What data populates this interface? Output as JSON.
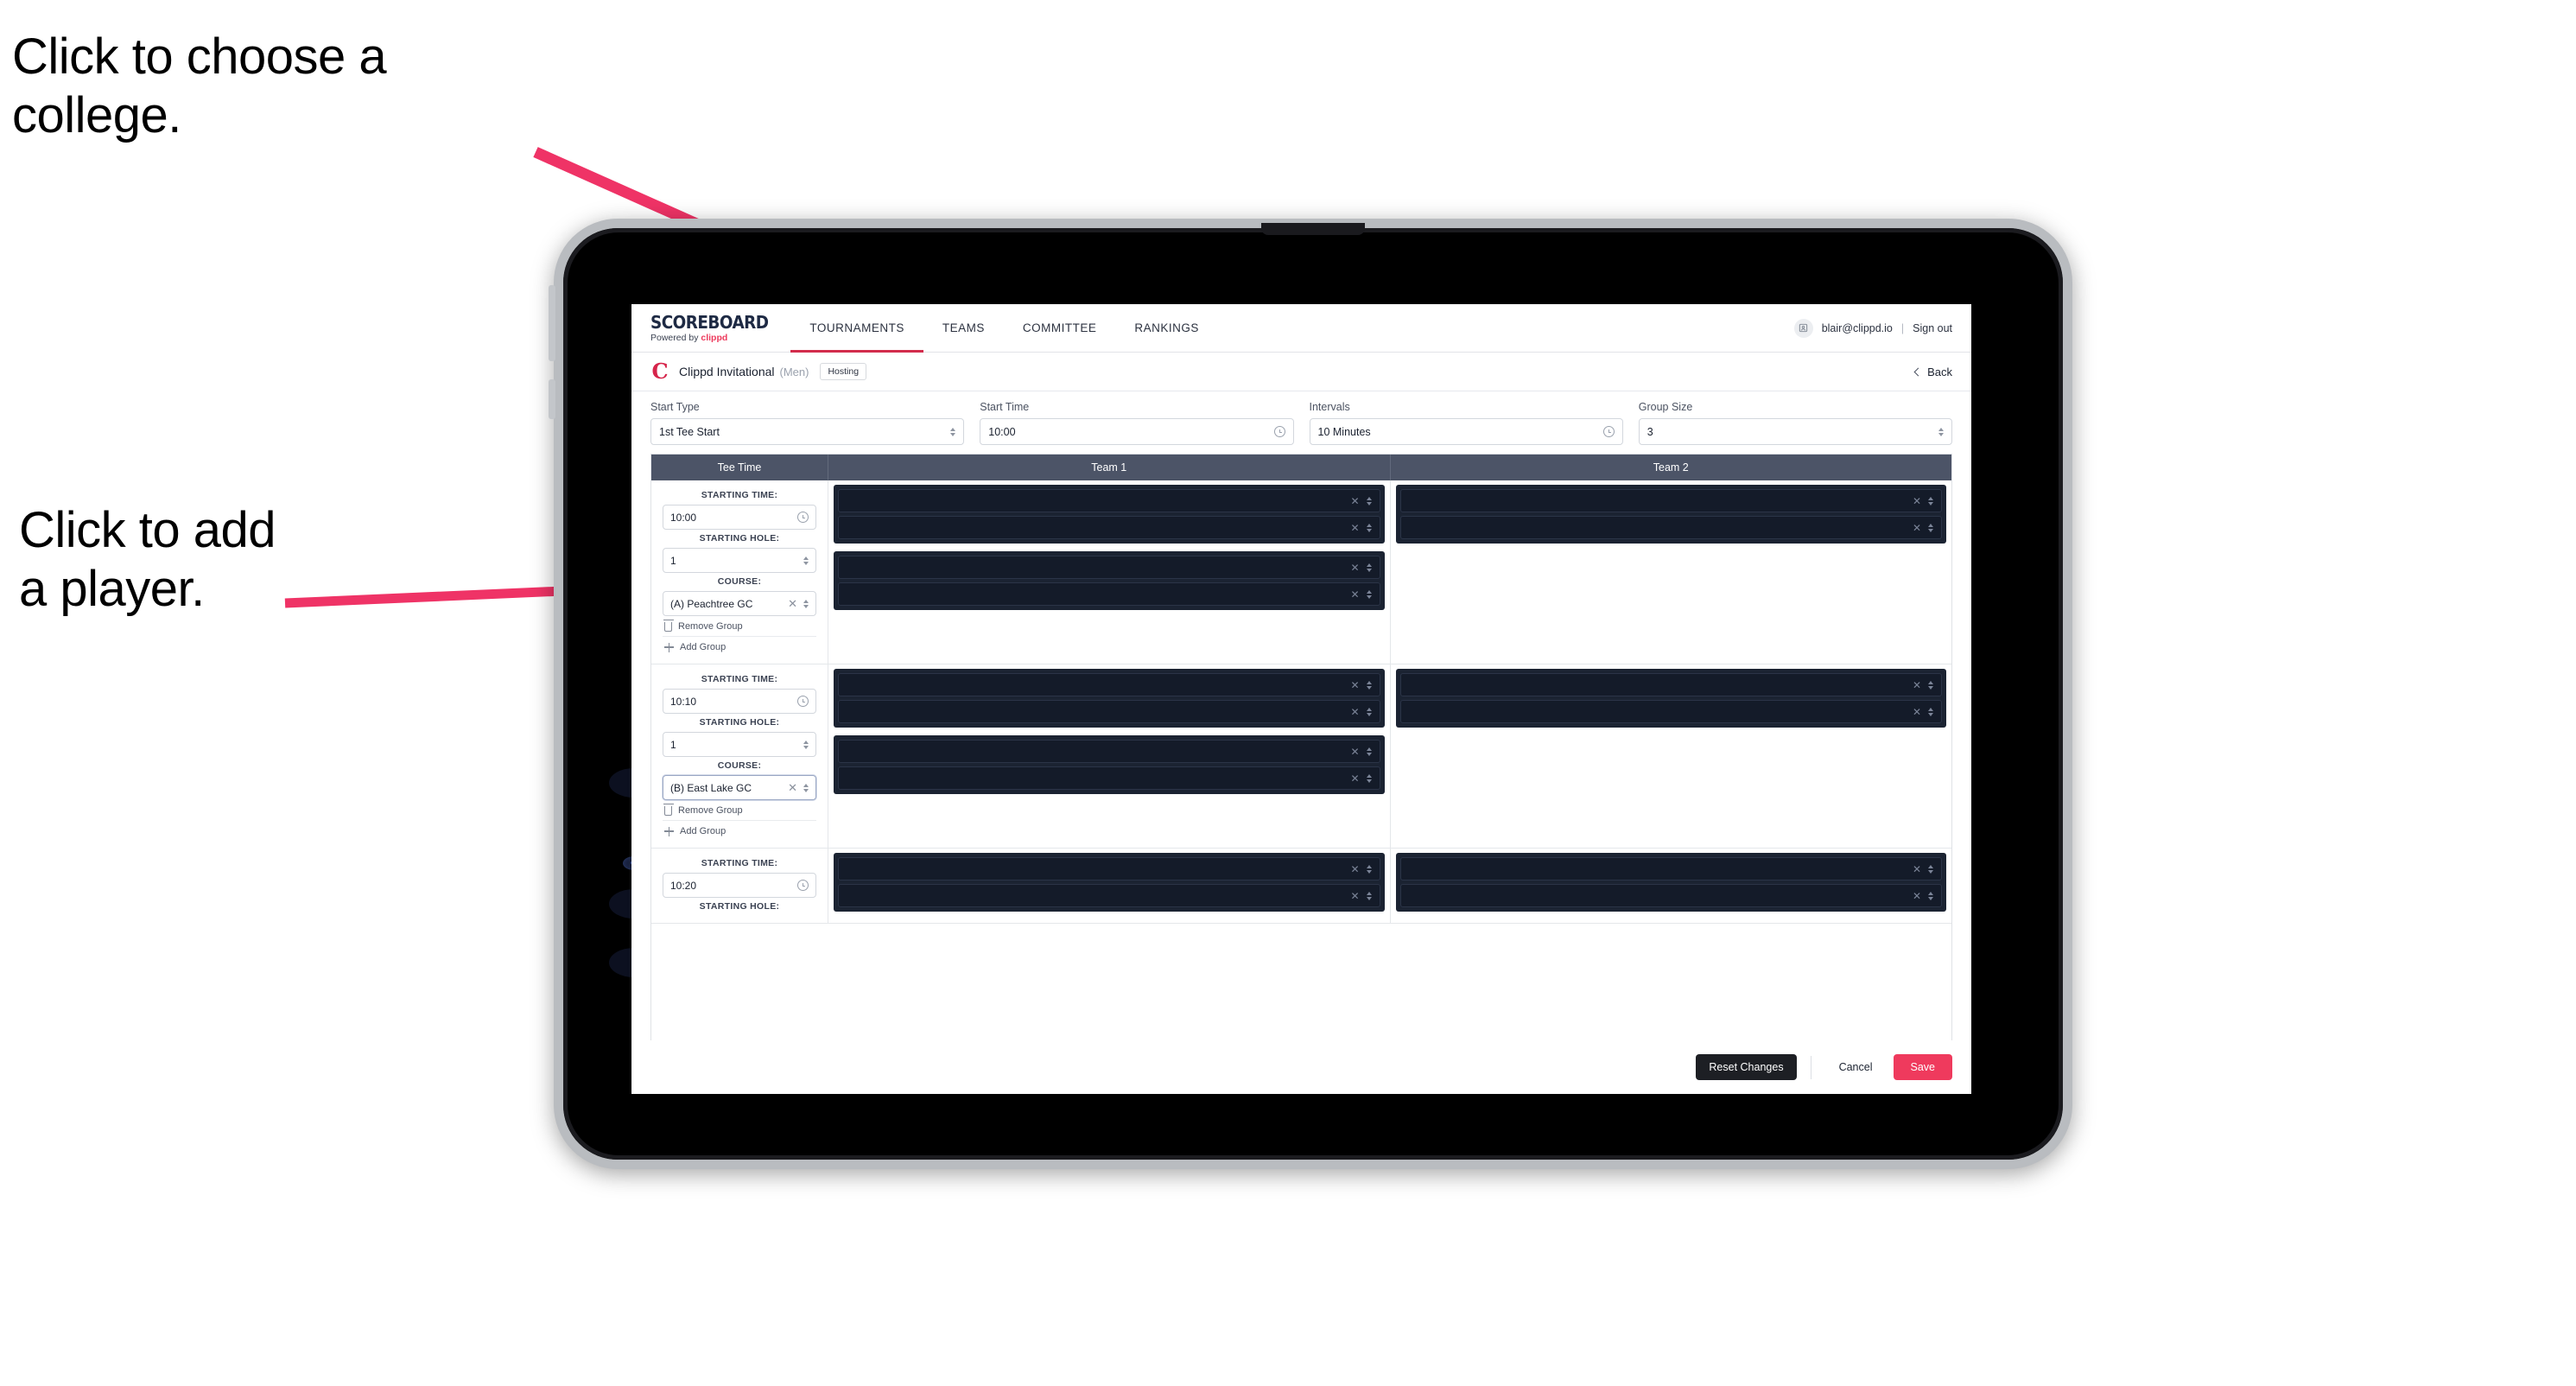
{
  "annotations": {
    "choose_college": "Click to choose a\ncollege.",
    "add_player": "Click to add\na player."
  },
  "colors": {
    "accent_pink": "#ef3a5d",
    "nav_active_underline": "#d22c4c",
    "table_header_bg": "#4c5467",
    "slot_dark_bg": "#141b29",
    "annotation_arrow": "#ef3366"
  },
  "topbar": {
    "brand_title": "SCOREBOARD",
    "brand_sub_prefix": "Powered by ",
    "brand_sub_name": "clippd",
    "tabs": [
      {
        "label": "TOURNAMENTS",
        "active": true
      },
      {
        "label": "TEAMS",
        "active": false
      },
      {
        "label": "COMMITTEE",
        "active": false
      },
      {
        "label": "RANKINGS",
        "active": false
      }
    ],
    "account": {
      "avatar_icon": "user-badge-icon",
      "email": "blair@clippd.io",
      "separator": "|",
      "sign_out": "Sign out"
    }
  },
  "breadcrumb": {
    "logo_glyph": "C",
    "title": "Clippd Invitational",
    "gender": "(Men)",
    "badge": "Hosting",
    "back_label": "Back"
  },
  "settings": {
    "fields": [
      {
        "label": "Start Type",
        "value": "1st Tee Start",
        "control": "select"
      },
      {
        "label": "Start Time",
        "value": "10:00",
        "control": "time"
      },
      {
        "label": "Intervals",
        "value": "10 Minutes",
        "control": "time"
      },
      {
        "label": "Group Size",
        "value": "3",
        "control": "select"
      }
    ]
  },
  "table": {
    "headers": [
      {
        "label": "Tee Time"
      },
      {
        "label": "Team 1"
      },
      {
        "label": "Team 2"
      }
    ],
    "labels": {
      "starting_time": "STARTING TIME:",
      "starting_hole": "STARTING HOLE:",
      "course": "COURSE:",
      "remove_group": "Remove Group",
      "add_group": "Add Group"
    },
    "rows": [
      {
        "starting_time": "10:00",
        "starting_hole": "1",
        "course": "(A) Peachtree GC",
        "course_focused": false,
        "team1": [
          {
            "slots": [
              "",
              ""
            ]
          },
          {
            "slots": [
              "",
              ""
            ]
          }
        ],
        "team2": [
          {
            "slots": [
              "",
              ""
            ]
          }
        ]
      },
      {
        "starting_time": "10:10",
        "starting_hole": "1",
        "course": "(B) East Lake GC",
        "course_focused": true,
        "team1": [
          {
            "slots": [
              "",
              ""
            ]
          },
          {
            "slots": [
              "",
              ""
            ]
          }
        ],
        "team2": [
          {
            "slots": [
              "",
              ""
            ]
          }
        ]
      },
      {
        "starting_time": "10:20",
        "starting_hole": "",
        "course": "",
        "course_focused": false,
        "team1": [
          {
            "slots": [
              "",
              ""
            ]
          }
        ],
        "team2": [
          {
            "slots": [
              "",
              ""
            ]
          }
        ]
      }
    ]
  },
  "footer": {
    "reset_label": "Reset Changes",
    "cancel_label": "Cancel",
    "save_label": "Save"
  }
}
